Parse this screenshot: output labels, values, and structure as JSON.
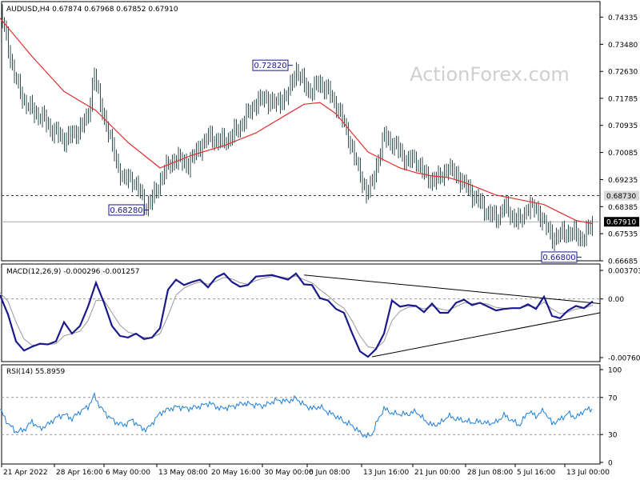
{
  "chart_data": [
    {
      "type": "candlestick",
      "title": "AUDUSD,H4 0.67874 0.67968 0.67852 0.67910",
      "watermark": "ActionForex.com",
      "ylim": [
        0.66685,
        0.7472
      ],
      "yticks": [
        0.74335,
        0.7348,
        0.7263,
        0.71785,
        0.70935,
        0.70085,
        0.69235,
        0.68385,
        0.67535,
        0.66685
      ],
      "ytick_labels": [
        "0.74335",
        "0.73480",
        "0.72630",
        "0.71785",
        "0.70935",
        "0.70085",
        "0.69235",
        "0.68385",
        "0.67535",
        "0.66685"
      ],
      "highlight_labels": [
        {
          "text": "0.68730",
          "value": 0.6873,
          "style": "gray"
        },
        {
          "text": "0.67910",
          "value": 0.6791,
          "style": "black"
        }
      ],
      "hlines": [
        {
          "value": 0.6873,
          "dash": "dashed",
          "color": "#333333"
        },
        {
          "value": 0.6791,
          "dash": "solid",
          "color": "#aaaaaa"
        }
      ],
      "price": {
        "x": [
          0,
          8,
          15,
          22,
          30,
          40,
          52,
          65,
          80,
          95,
          110,
          118,
          125,
          135,
          145,
          155,
          165,
          175,
          183,
          190,
          200,
          210,
          222,
          235,
          248,
          262,
          275,
          290,
          305,
          318,
          330,
          345,
          360,
          370,
          380,
          390,
          400,
          410,
          420,
          430,
          440,
          450,
          458,
          465,
          472,
          480,
          490,
          500,
          510,
          520,
          530,
          540,
          550,
          560,
          570,
          580,
          590,
          600,
          610,
          620,
          630,
          640,
          650,
          660,
          670,
          680,
          690,
          700,
          710,
          720,
          730,
          741
        ],
        "y": [
          0.7455,
          0.737,
          0.728,
          0.722,
          0.717,
          0.714,
          0.712,
          0.708,
          0.705,
          0.707,
          0.712,
          0.726,
          0.716,
          0.708,
          0.698,
          0.692,
          0.693,
          0.688,
          0.684,
          0.686,
          0.692,
          0.697,
          0.699,
          0.697,
          0.702,
          0.706,
          0.704,
          0.706,
          0.711,
          0.716,
          0.718,
          0.716,
          0.719,
          0.727,
          0.722,
          0.72,
          0.723,
          0.72,
          0.716,
          0.71,
          0.702,
          0.694,
          0.688,
          0.691,
          0.698,
          0.706,
          0.704,
          0.701,
          0.698,
          0.699,
          0.694,
          0.692,
          0.693,
          0.696,
          0.694,
          0.691,
          0.688,
          0.685,
          0.682,
          0.68,
          0.684,
          0.681,
          0.679,
          0.684,
          0.683,
          0.679,
          0.674,
          0.675,
          0.676,
          0.675,
          0.674,
          0.6791
        ]
      },
      "ma": {
        "name": "",
        "color": "#e03030",
        "x": [
          0,
          40,
          80,
          120,
          160,
          200,
          240,
          280,
          320,
          360,
          380,
          400,
          420,
          440,
          460,
          480,
          500,
          520,
          540,
          560,
          580,
          600,
          620,
          640,
          660,
          680,
          700,
          720,
          741
        ],
        "y": [
          0.743,
          0.731,
          0.72,
          0.714,
          0.704,
          0.696,
          0.7,
          0.703,
          0.707,
          0.713,
          0.716,
          0.7165,
          0.713,
          0.707,
          0.701,
          0.6985,
          0.696,
          0.6945,
          0.6935,
          0.693,
          0.6915,
          0.6895,
          0.6875,
          0.6865,
          0.6855,
          0.6845,
          0.682,
          0.6795,
          0.6785
        ]
      },
      "annotations": [
        {
          "text": "0.72820",
          "value": 0.7282,
          "anchor": "right",
          "x": 360
        },
        {
          "text": "0.68280",
          "value": 0.6828,
          "anchor": "right",
          "x": 180
        },
        {
          "text": "0.66800",
          "value": 0.668,
          "anchor": "right",
          "x": 721
        }
      ]
    },
    {
      "type": "line",
      "title": "MACD(12,26,9) -0.000296 -0.001257",
      "ylim": [
        -0.007608,
        0.003703
      ],
      "ytick_labels": [
        {
          "text": "0.003703",
          "value": 0.003703
        },
        {
          "text": "0.00",
          "value": 0.0
        },
        {
          "text": "-0.007608",
          "value": -0.007608
        }
      ],
      "zero_line": 0.0,
      "series": [
        {
          "name": "",
          "role": "macd",
          "color": "#1a1a8c",
          "x": [
            0,
            10,
            20,
            30,
            40,
            50,
            60,
            70,
            80,
            90,
            100,
            110,
            120,
            130,
            140,
            150,
            160,
            170,
            180,
            190,
            200,
            210,
            220,
            230,
            240,
            250,
            260,
            270,
            280,
            290,
            300,
            310,
            320,
            330,
            340,
            350,
            360,
            370,
            380,
            390,
            400,
            410,
            420,
            430,
            440,
            450,
            460,
            470,
            480,
            490,
            500,
            510,
            520,
            530,
            540,
            550,
            560,
            570,
            580,
            590,
            600,
            610,
            620,
            630,
            640,
            650,
            660,
            670,
            680,
            690,
            700,
            710,
            720,
            730,
            741
          ],
          "y": [
            0.0005,
            -0.002,
            -0.0055,
            -0.0067,
            -0.0062,
            -0.0058,
            -0.0059,
            -0.0055,
            -0.003,
            -0.0045,
            -0.0035,
            -0.001,
            0.0021,
            -0.0005,
            -0.0035,
            -0.0048,
            -0.005,
            -0.0045,
            -0.0052,
            -0.005,
            -0.0038,
            0.0012,
            0.0025,
            0.0018,
            0.0022,
            0.0025,
            0.0015,
            0.0028,
            0.0033,
            0.0022,
            0.0016,
            0.0018,
            0.0029,
            0.003,
            0.0031,
            0.0028,
            0.0025,
            0.0033,
            0.0019,
            0.0018,
            0.0001,
            -0.0002,
            -0.0013,
            -0.0018,
            -0.0044,
            -0.0068,
            -0.0075,
            -0.0065,
            -0.0045,
            -0.0002,
            -0.001,
            -0.0008,
            -0.0009,
            -0.0017,
            -0.0006,
            -0.0018,
            -0.0018,
            -0.0005,
            -0.0001,
            -0.0008,
            -0.0005,
            -0.001,
            -0.0015,
            -0.0013,
            -0.0012,
            -0.0012,
            -0.0007,
            -0.0013,
            0.0003,
            -0.0022,
            -0.0025,
            -0.0015,
            -0.0009,
            -0.0012,
            -0.0003
          ]
        },
        {
          "name": "",
          "role": "signal",
          "color": "#999999",
          "x": [
            0,
            10,
            20,
            30,
            40,
            50,
            60,
            70,
            80,
            90,
            100,
            110,
            120,
            130,
            140,
            150,
            160,
            170,
            180,
            190,
            200,
            210,
            220,
            230,
            240,
            250,
            260,
            270,
            280,
            290,
            300,
            310,
            320,
            330,
            340,
            350,
            360,
            370,
            380,
            390,
            400,
            410,
            420,
            430,
            440,
            450,
            460,
            470,
            480,
            490,
            500,
            510,
            520,
            530,
            540,
            550,
            560,
            570,
            580,
            590,
            600,
            610,
            620,
            630,
            640,
            650,
            660,
            670,
            680,
            690,
            700,
            710,
            720,
            730,
            741
          ],
          "y": [
            0.0008,
            -0.0003,
            -0.003,
            -0.0052,
            -0.006,
            -0.0059,
            -0.0059,
            -0.0058,
            -0.0048,
            -0.0045,
            -0.0042,
            -0.0028,
            -0.0002,
            -0.0002,
            -0.0018,
            -0.0034,
            -0.0043,
            -0.0046,
            -0.005,
            -0.005,
            -0.0045,
            -0.0022,
            0.0005,
            0.0014,
            0.0019,
            0.0022,
            0.0019,
            0.0023,
            0.0028,
            0.0026,
            0.0021,
            0.0019,
            0.0024,
            0.0027,
            0.0029,
            0.0029,
            0.0027,
            0.003,
            0.0025,
            0.0021,
            0.0012,
            0.0004,
            -0.0005,
            -0.0012,
            -0.0028,
            -0.0048,
            -0.0062,
            -0.0064,
            -0.0055,
            -0.0028,
            -0.0016,
            -0.0011,
            -0.001,
            -0.0013,
            -0.0009,
            -0.0013,
            -0.0015,
            -0.001,
            -0.0005,
            -0.0006,
            -0.0005,
            -0.0007,
            -0.0011,
            -0.0012,
            -0.0012,
            -0.0012,
            -0.0009,
            -0.0011,
            -0.0004,
            -0.0013,
            -0.0019,
            -0.0017,
            -0.0013,
            -0.0012,
            -0.0008
          ]
        }
      ],
      "trendlines": [
        {
          "x": [
            380,
            750
          ],
          "y": [
            0.0031,
            -0.0006
          ]
        },
        {
          "x": [
            465,
            750
          ],
          "y": [
            -0.0075,
            -0.0018
          ]
        }
      ]
    },
    {
      "type": "line",
      "title": "RSI(14) 55.8959",
      "ylim": [
        0,
        100
      ],
      "yticks": [
        100,
        70,
        30,
        0
      ],
      "ytick_labels": [
        "100",
        "70",
        "30",
        "0"
      ],
      "levels": [
        70,
        30
      ],
      "series": [
        {
          "name": "",
          "color": "#1e7fd9",
          "x": [
            0,
            10,
            20,
            30,
            40,
            50,
            60,
            70,
            80,
            90,
            100,
            110,
            118,
            125,
            135,
            145,
            155,
            165,
            175,
            183,
            190,
            200,
            210,
            222,
            235,
            248,
            262,
            275,
            290,
            305,
            318,
            330,
            345,
            360,
            370,
            380,
            390,
            400,
            410,
            420,
            430,
            440,
            450,
            458,
            465,
            472,
            480,
            490,
            500,
            510,
            520,
            530,
            540,
            550,
            560,
            570,
            580,
            590,
            600,
            610,
            620,
            630,
            640,
            650,
            660,
            670,
            680,
            690,
            700,
            710,
            720,
            730,
            741
          ],
          "y": [
            57,
            42,
            33,
            35,
            44,
            36,
            41,
            48,
            52,
            47,
            55,
            60,
            72,
            60,
            50,
            43,
            40,
            46,
            38,
            35,
            42,
            53,
            57,
            60,
            58,
            60,
            64,
            58,
            60,
            64,
            62,
            61,
            67,
            66,
            69,
            62,
            58,
            60,
            54,
            50,
            44,
            40,
            32,
            28,
            30,
            45,
            58,
            53,
            52,
            52,
            55,
            46,
            40,
            42,
            50,
            47,
            45,
            43,
            44,
            42,
            43,
            51,
            45,
            40,
            55,
            50,
            56,
            42,
            46,
            53,
            48,
            56,
            58
          ]
        }
      ]
    }
  ],
  "x_axis": {
    "tick_labels": [
      "21 Apr 2022",
      "28 Apr 16:00",
      "6 May 00:00",
      "13 May 08:00",
      "20 May 16:00",
      "30 May 00:00",
      "6 Jun 08:00",
      "13 Jun 16:00",
      "21 Jun 00:00",
      "28 Jun 08:00",
      "5 Jul 16:00",
      "13 Jul 00:00"
    ]
  }
}
